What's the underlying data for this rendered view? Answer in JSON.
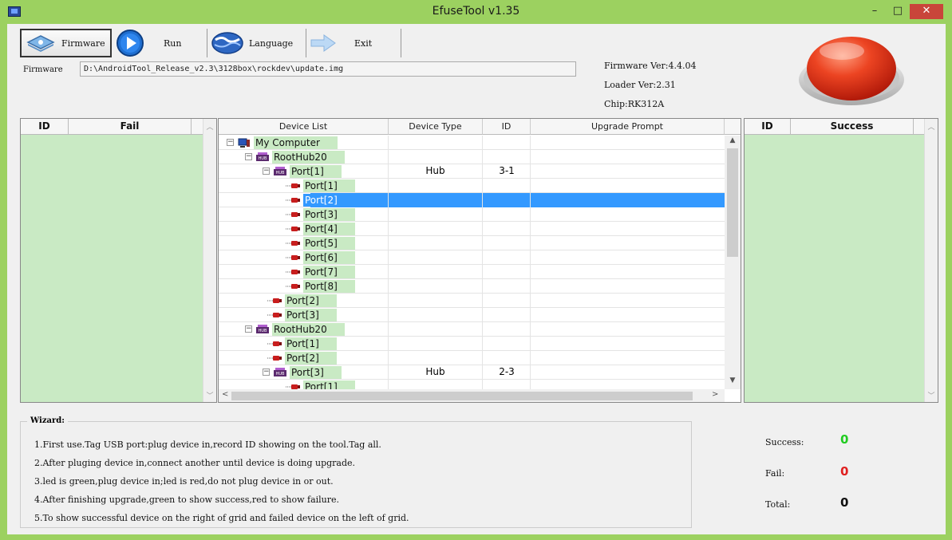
{
  "window": {
    "title": "EfuseTool v1.35",
    "minimize_glyph": "–",
    "maximize_glyph": "□",
    "close_glyph": "✕"
  },
  "toolbar": {
    "firmware_label": "Firmware",
    "run_label": "Run",
    "language_label": "Language",
    "exit_label": "Exit",
    "icons": [
      "firmware-icon",
      "run-play-icon",
      "language-globe-icon",
      "exit-arrow-icon"
    ]
  },
  "firmware": {
    "label": "Firmware",
    "path": "D:\\AndroidTool_Release_v2.3\\3128box\\rockdev\\update.img"
  },
  "info": {
    "firmware_ver": "Firmware Ver:4.4.04",
    "loader_ver": "Loader Ver:2.31",
    "chip": "Chip:RK312A"
  },
  "fail_grid": {
    "headers": [
      "ID",
      "Fail"
    ]
  },
  "success_grid": {
    "headers": [
      "ID",
      "Success"
    ]
  },
  "device_grid": {
    "headers": [
      "Device List",
      "Device Type",
      "ID",
      "Upgrade Prompt"
    ],
    "rows": [
      {
        "label": "My Computer",
        "level": 0,
        "icon": "computer-icon",
        "expander": "−",
        "type": "",
        "id": ""
      },
      {
        "label": "RootHub20",
        "level": 1,
        "icon": "hub-icon",
        "expander": "−",
        "type": "",
        "id": ""
      },
      {
        "label": "Port[1]",
        "level": 2,
        "icon": "hub-icon",
        "expander": "−",
        "type": "Hub",
        "id": "3-1"
      },
      {
        "label": "Port[1]",
        "level": 3,
        "icon": "usb-icon",
        "expander": "",
        "type": "",
        "id": ""
      },
      {
        "label": "Port[2]",
        "level": 3,
        "icon": "usb-icon",
        "expander": "",
        "type": "",
        "id": "",
        "selected": true
      },
      {
        "label": "Port[3]",
        "level": 3,
        "icon": "usb-icon",
        "expander": "",
        "type": "",
        "id": ""
      },
      {
        "label": "Port[4]",
        "level": 3,
        "icon": "usb-icon",
        "expander": "",
        "type": "",
        "id": ""
      },
      {
        "label": "Port[5]",
        "level": 3,
        "icon": "usb-icon",
        "expander": "",
        "type": "",
        "id": ""
      },
      {
        "label": "Port[6]",
        "level": 3,
        "icon": "usb-icon",
        "expander": "",
        "type": "",
        "id": ""
      },
      {
        "label": "Port[7]",
        "level": 3,
        "icon": "usb-icon",
        "expander": "",
        "type": "",
        "id": ""
      },
      {
        "label": "Port[8]",
        "level": 3,
        "icon": "usb-icon",
        "expander": "",
        "type": "",
        "id": ""
      },
      {
        "label": "Port[2]",
        "level": 2,
        "icon": "usb-icon",
        "expander": "",
        "type": "",
        "id": ""
      },
      {
        "label": "Port[3]",
        "level": 2,
        "icon": "usb-icon",
        "expander": "",
        "type": "",
        "id": ""
      },
      {
        "label": "RootHub20",
        "level": 1,
        "icon": "hub-icon",
        "expander": "−",
        "type": "",
        "id": ""
      },
      {
        "label": "Port[1]",
        "level": 2,
        "icon": "usb-icon",
        "expander": "",
        "type": "",
        "id": ""
      },
      {
        "label": "Port[2]",
        "level": 2,
        "icon": "usb-icon",
        "expander": "",
        "type": "",
        "id": ""
      },
      {
        "label": "Port[3]",
        "level": 2,
        "icon": "hub-icon",
        "expander": "−",
        "type": "Hub",
        "id": "2-3"
      },
      {
        "label": "Port[1]",
        "level": 3,
        "icon": "usb-icon",
        "expander": "",
        "type": "",
        "id": ""
      }
    ]
  },
  "wizard": {
    "title": "Wizard:",
    "lines": [
      "1.First use.Tag USB port:plug device in,record ID showing on the tool.Tag all.",
      "2.After pluging device in,connect another until device is doing upgrade.",
      "3.led is green,plug device in;led is red,do not plug device in or out.",
      "4.After finishing upgrade,green to show success,red to show failure.",
      "5.To show successful device on the right of grid and failed device on the left of grid."
    ]
  },
  "stats": {
    "success_label": "Success:",
    "success_value": "0",
    "fail_label": "Fail:",
    "fail_value": "0",
    "total_label": "Total:",
    "total_value": "0"
  },
  "colors": {
    "frame": "#9cd160",
    "grid_bg": "#c9eac4",
    "selection": "#3399ff",
    "success": "#22cc22",
    "fail": "#e02020",
    "big_button": "#e8402a"
  }
}
